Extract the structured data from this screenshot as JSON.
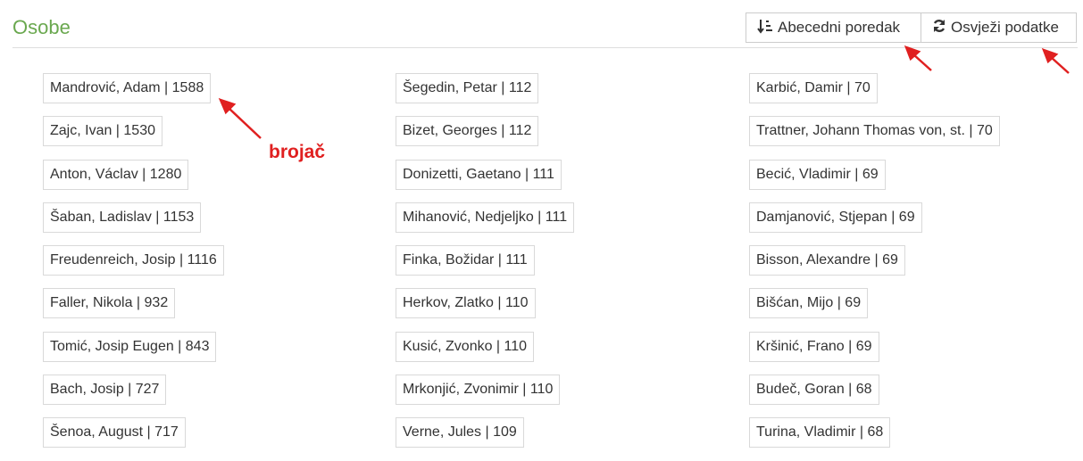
{
  "page": {
    "title": "Osobe"
  },
  "toolbar": {
    "sort_label": "Abecedni poredak",
    "sort_icon": "sort-alpha-icon",
    "refresh_label": "Osvježi podatke",
    "refresh_icon": "refresh-icon"
  },
  "columns": [
    [
      "Mandrović, Adam | 1588",
      "Zajc, Ivan | 1530",
      "Anton, Václav | 1280",
      "Šaban, Ladislav | 1153",
      "Freudenreich, Josip | 1116",
      "Faller, Nikola | 932",
      "Tomić, Josip Eugen | 843",
      "Bach, Josip | 727",
      "Šenoa, August | 717"
    ],
    [
      "Šegedin, Petar | 112",
      "Bizet, Georges | 112",
      "Donizetti, Gaetano | 111",
      "Mihanović, Nedjeljko | 111",
      "Finka, Božidar | 111",
      "Herkov, Zlatko | 110",
      "Kusić, Zvonko | 110",
      "Mrkonjić, Zvonimir | 110",
      "Verne, Jules | 109"
    ],
    [
      "Karbić, Damir | 70",
      "Trattner, Johann Thomas von, st. | 70",
      "Becić, Vladimir | 69",
      "Damjanović, Stjepan | 69",
      "Bisson, Alexandre | 69",
      "Bišćan, Mijo | 69",
      "Kršinić, Frano | 69",
      "Budeč, Goran | 68",
      "Turina, Vladimir | 68"
    ]
  ],
  "annotation": {
    "label": "brojač",
    "color": "#e02020"
  },
  "colors": {
    "title": "#6aa84f",
    "border": "#d9d9d9"
  }
}
